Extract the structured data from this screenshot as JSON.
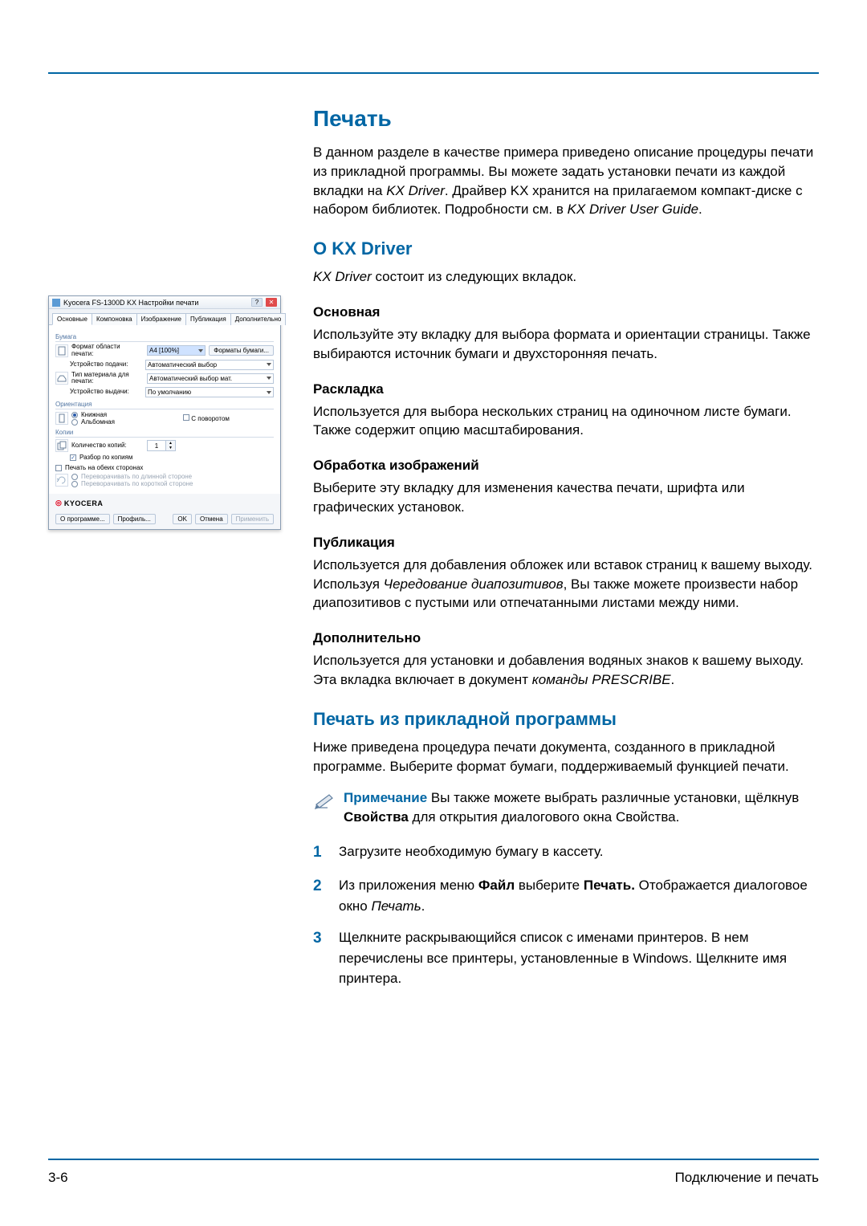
{
  "page": {
    "numberLeft": "3-6",
    "footerRight": "Подключение и печать"
  },
  "h1": "Печать",
  "intro": {
    "p1a": "В данном разделе в качестве примера приведено описание процедуры печати из прикладной программы. Вы можете задать установки печати из каждой вкладки на ",
    "p1b": "KX Driver",
    "p1c": ". Драйвер KX хранится на прилагаемом компакт-диске с набором библиотек. Подробности см. в ",
    "p1d": "KX Driver User Guide",
    "p1e": "."
  },
  "h2a": "О KX Driver",
  "kx": {
    "p2a": "KX Driver",
    "p2b": " состоит из следующих вкладок."
  },
  "tabs": {
    "t1": {
      "title": "Основная",
      "body": "Используйте эту вкладку для выбора формата и ориентации страницы. Также выбираются источник бумаги и двухсторонняя печать."
    },
    "t2": {
      "title": "Раскладка",
      "body": "Используется для выбора нескольких страниц на одиночном листе бумаги. Также содержит опцию масштабирования."
    },
    "t3": {
      "title": "Обработка изображений",
      "body": "Выберите эту вкладку для изменения качества печати, шрифта или графических установок."
    },
    "t4": {
      "title": "Публикация",
      "b1": "Используется для добавления обложек или вставок страниц к вашему выходу. Используя ",
      "b2": "Чередование диапозитивов",
      "b3": ", Вы также можете произвести набор диапозитивов с пустыми или отпечатанными листами между ними."
    },
    "t5": {
      "title": "Дополнительно",
      "b1": "Используется для установки и добавления водяных знаков к вашему выходу. Эта вкладка включает в документ ",
      "b2": "команды PRESCRIBE",
      "b3": "."
    }
  },
  "h2b": "Печать из прикладной программы",
  "app": {
    "intro": "Ниже приведена процедура печати документа, созданного в прикладной программе. Выберите формат бумаги, поддерживаемый функцией печати.",
    "note": {
      "label": "Примечание",
      "t1": "  Вы также можете выбрать различные установки, щёлкнув ",
      "t2": "Свойства",
      "t3": " для открытия диалогового окна Свойства."
    },
    "steps": {
      "s1": "Загрузите необходимую бумагу в кассету.",
      "s2a": "Из приложения меню ",
      "s2b": "Файл",
      "s2c": " выберите ",
      "s2d": "Печать.",
      "s2e": " Отображается диалоговое окно ",
      "s2f": "Печать",
      "s2g": ".",
      "s3": "Щелкните раскрывающийся список с именами принтеров. В нем перечислены все принтеры, установленные в Windows. Щелкните имя принтера."
    }
  },
  "dlg": {
    "title": "Kyocera FS-1300D KX Настройки печати",
    "close": "✕",
    "help": "?",
    "tabs": [
      "Основные",
      "Компоновка",
      "Изображение",
      "Публикация",
      "Дополнительно"
    ],
    "paper": "Бумага",
    "printArea": "Формат области печати:",
    "a4": "A4 [100%]",
    "sizesBtn": "Форматы бумаги...",
    "source": "Устройство подачи:",
    "sourceVal": "Автоматический выбор",
    "media": "Тип материала для печати:",
    "mediaVal": "Автоматический выбор мат.",
    "output": "Устройство выдачи:",
    "outputVal": "По умолчанию",
    "orient": "Ориентация",
    "portrait": "Книжная",
    "landscape": "Альбомная",
    "rotate": "С поворотом",
    "copies": "Копии",
    "copiesLbl": "Количество копий:",
    "copiesVal": "1",
    "collate": "Разбор по копиям",
    "duplex": "Печать на обеих сторонах",
    "flipL": "Переворачивать по длинной стороне",
    "flipS": "Переворачивать по короткой стороне",
    "brand": "KYOCERA",
    "about": "О программе...",
    "profile": "Профиль...",
    "ok": "OK",
    "cancel": "Отмена",
    "apply": "Применить"
  }
}
